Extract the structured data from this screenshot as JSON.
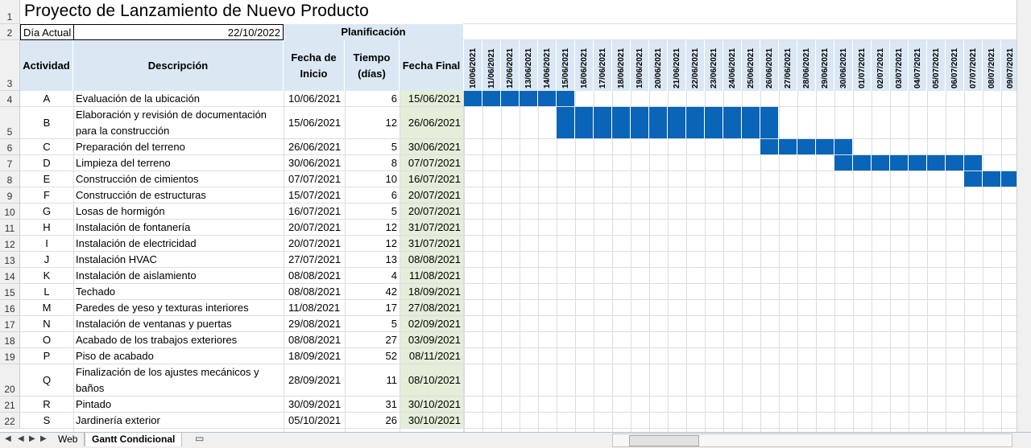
{
  "title": "Proyecto de Lanzamiento de Nuevo Producto",
  "dia_actual_label": "Día Actual",
  "dia_actual_value": "22/10/2022",
  "planificacion_label": "Planificación",
  "headers": {
    "actividad": "Actividad",
    "descripcion": "Descripción",
    "fecha_inicio": "Fecha de Inicio",
    "tiempo": "Tiempo (días)",
    "fecha_final": "Fecha Final"
  },
  "row_numbers": [
    "1",
    "2",
    "3",
    "4",
    "5",
    "6",
    "7",
    "8",
    "9",
    "10",
    "11",
    "12",
    "13",
    "14",
    "15",
    "16",
    "17",
    "18",
    "19",
    "20",
    "21",
    "22"
  ],
  "dates": [
    "10/06/2021",
    "11/06/2021",
    "12/06/2021",
    "13/06/2021",
    "14/06/2021",
    "15/06/2021",
    "16/06/2021",
    "17/06/2021",
    "18/06/2021",
    "19/06/2021",
    "20/06/2021",
    "21/06/2021",
    "22/06/2021",
    "23/06/2021",
    "24/06/2021",
    "25/06/2021",
    "26/06/2021",
    "27/06/2021",
    "28/06/2021",
    "29/06/2021",
    "30/06/2021",
    "01/07/2021",
    "02/07/2021",
    "03/07/2021",
    "04/07/2021",
    "05/07/2021",
    "06/07/2021",
    "07/07/2021",
    "08/07/2021",
    "09/07/2021"
  ],
  "tasks": [
    {
      "id": "A",
      "desc": "Evaluación de la ubicación",
      "start": "10/06/2021",
      "days": "6",
      "end": "15/06/2021"
    },
    {
      "id": "B",
      "desc": "Elaboración y revisión de documentación para la construcción",
      "start": "15/06/2021",
      "days": "12",
      "end": "26/06/2021"
    },
    {
      "id": "C",
      "desc": "Preparación del terreno",
      "start": "26/06/2021",
      "days": "5",
      "end": "30/06/2021"
    },
    {
      "id": "D",
      "desc": "Limpieza del terreno",
      "start": "30/06/2021",
      "days": "8",
      "end": "07/07/2021"
    },
    {
      "id": "E",
      "desc": "Construcción de cimientos",
      "start": "07/07/2021",
      "days": "10",
      "end": "16/07/2021"
    },
    {
      "id": "F",
      "desc": "Construcción de estructuras",
      "start": "15/07/2021",
      "days": "6",
      "end": "20/07/2021"
    },
    {
      "id": "G",
      "desc": "Losas de hormigón",
      "start": "16/07/2021",
      "days": "5",
      "end": "20/07/2021"
    },
    {
      "id": "H",
      "desc": "Instalación de fontanería",
      "start": "20/07/2021",
      "days": "12",
      "end": "31/07/2021"
    },
    {
      "id": "I",
      "desc": "Instalación de electricidad",
      "start": "20/07/2021",
      "days": "12",
      "end": "31/07/2021"
    },
    {
      "id": "J",
      "desc": "Instalación HVAC",
      "start": "27/07/2021",
      "days": "13",
      "end": "08/08/2021"
    },
    {
      "id": "K",
      "desc": "Instalación de aislamiento",
      "start": "08/08/2021",
      "days": "4",
      "end": "11/08/2021"
    },
    {
      "id": "L",
      "desc": "Techado",
      "start": "08/08/2021",
      "days": "42",
      "end": "18/09/2021"
    },
    {
      "id": "M",
      "desc": "Paredes de yeso y texturas interiores",
      "start": "11/08/2021",
      "days": "17",
      "end": "27/08/2021"
    },
    {
      "id": "N",
      "desc": "Instalación de ventanas y puertas",
      "start": "29/08/2021",
      "days": "5",
      "end": "02/09/2021"
    },
    {
      "id": "O",
      "desc": "Acabado de los trabajos exteriores",
      "start": "08/08/2021",
      "days": "27",
      "end": "03/09/2021"
    },
    {
      "id": "P",
      "desc": "Piso de acabado",
      "start": "18/09/2021",
      "days": "52",
      "end": "08/11/2021"
    },
    {
      "id": "Q",
      "desc": "Finalización de los ajustes mecánicos y baños",
      "start": "28/09/2021",
      "days": "11",
      "end": "08/10/2021"
    },
    {
      "id": "R",
      "desc": "Pintado",
      "start": "30/09/2021",
      "days": "31",
      "end": "30/10/2021"
    },
    {
      "id": "S",
      "desc": "Jardinería exterior",
      "start": "05/10/2021",
      "days": "26",
      "end": "30/10/2021"
    }
  ],
  "sheet_tabs": [
    "Web",
    "Gantt Condicional"
  ],
  "active_tab": "Gantt Condicional",
  "colors": {
    "bar": "#0a64b8",
    "header_fill": "#dbe8f4",
    "final_fill": "#e4eed9"
  }
}
